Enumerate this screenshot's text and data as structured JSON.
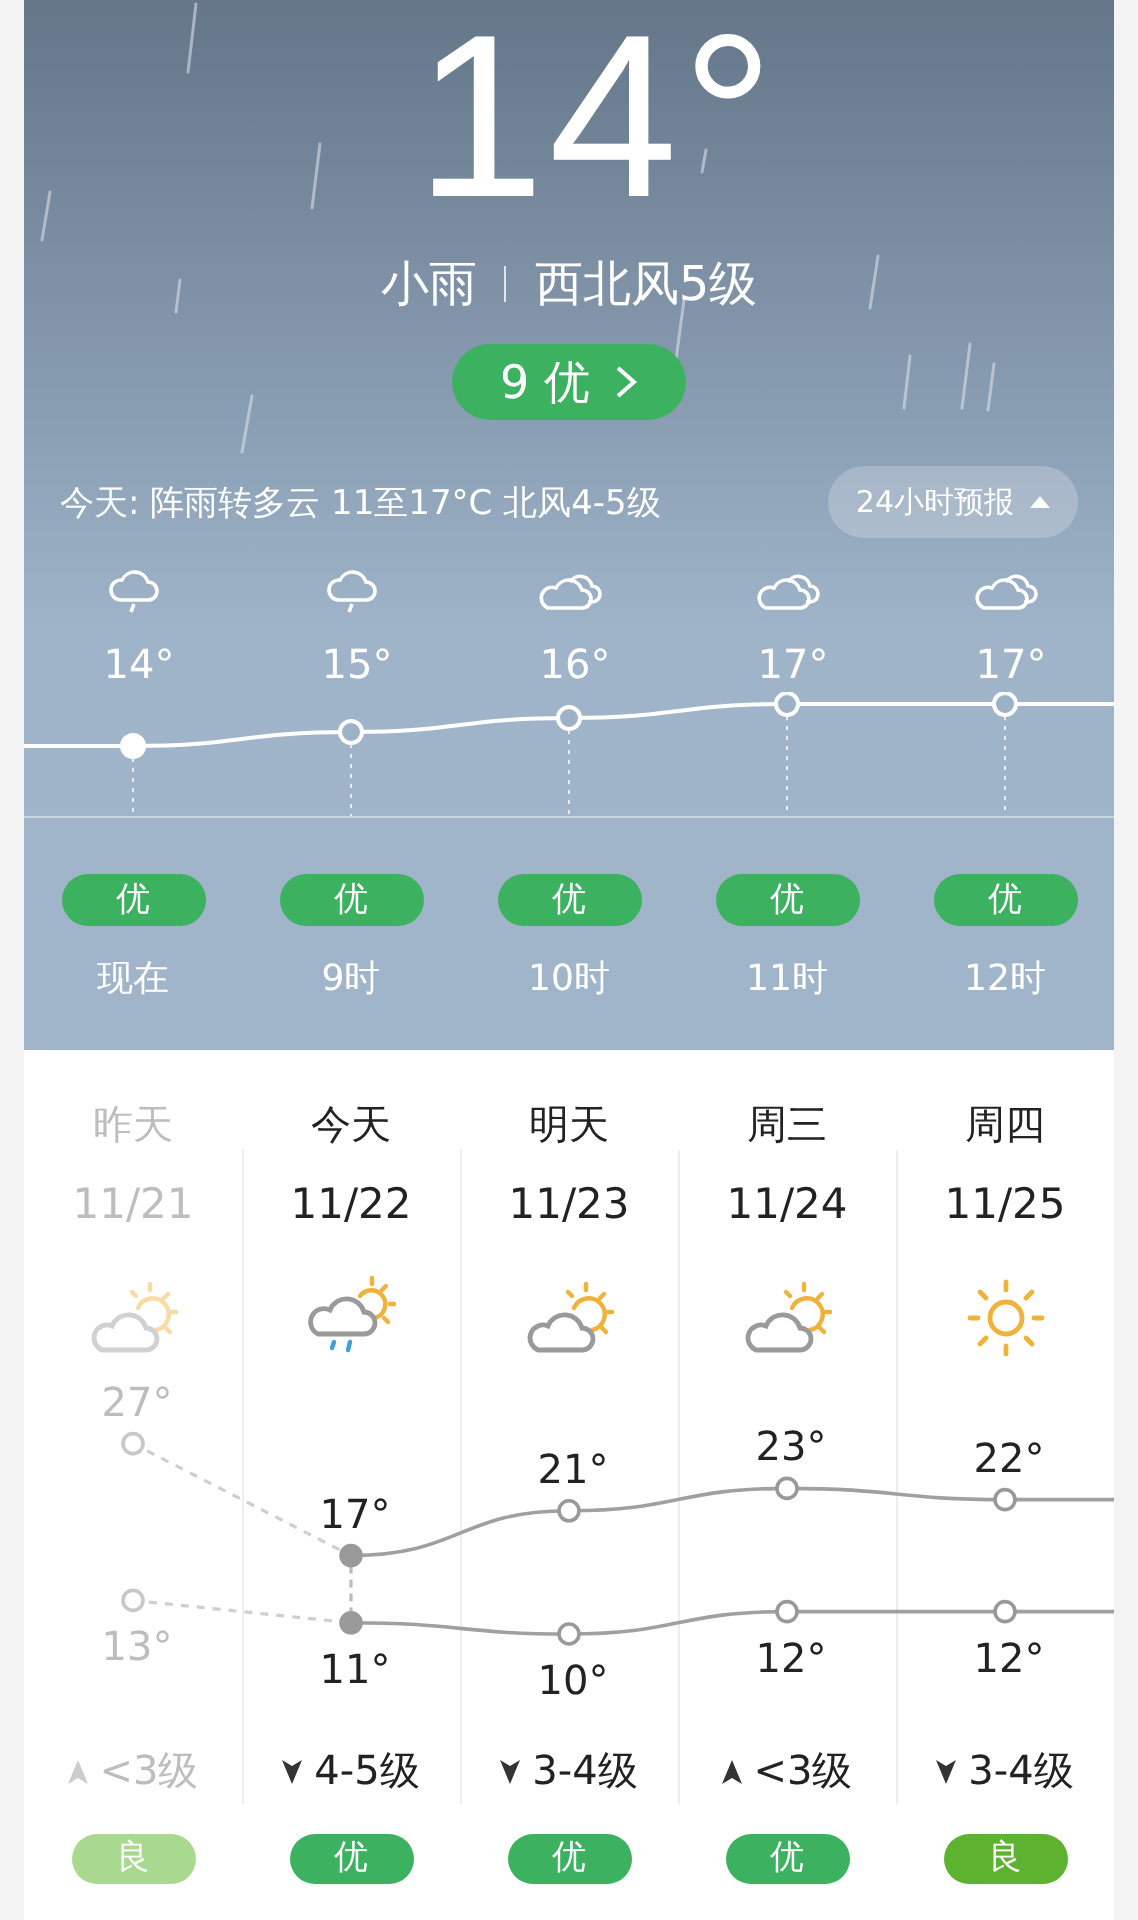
{
  "current": {
    "temperature": "14°",
    "condition": "小雨",
    "wind": "西北风5级",
    "aqi": "9 优"
  },
  "today_summary": "今天: 阵雨转多云 11至17°C 北风4-5级",
  "forecast_toggle": {
    "label": "24小时预报",
    "expanded": true
  },
  "hourly": [
    {
      "kind": "rain",
      "temp": "14°",
      "aqi": "优",
      "time": "现在",
      "current": true
    },
    {
      "kind": "rain",
      "temp": "15°",
      "aqi": "优",
      "time": "9时",
      "current": false
    },
    {
      "kind": "cloudy",
      "temp": "16°",
      "aqi": "优",
      "time": "10时",
      "current": false
    },
    {
      "kind": "cloudy",
      "temp": "17°",
      "aqi": "优",
      "time": "11时",
      "current": false
    },
    {
      "kind": "cloudy",
      "temp": "17°",
      "aqi": "优",
      "time": "12时",
      "current": false
    }
  ],
  "daily": [
    {
      "day": "昨天",
      "date": "11/21",
      "kind": "partly_cloudy",
      "high": "27°",
      "low": "13°",
      "wind_up": true,
      "wind": "<3级",
      "aqi": "良",
      "color": "#a9d88f",
      "past": true
    },
    {
      "day": "今天",
      "date": "11/22",
      "kind": "shower",
      "high": "17°",
      "low": "11°",
      "wind_up": false,
      "wind": "4-5级",
      "aqi": "优",
      "color": "#3cb15f",
      "past": false
    },
    {
      "day": "明天",
      "date": "11/23",
      "kind": "partly_cloudy",
      "high": "21°",
      "low": "10°",
      "wind_up": false,
      "wind": "3-4级",
      "aqi": "优",
      "color": "#3cb15f",
      "past": false
    },
    {
      "day": "周三",
      "date": "11/24",
      "kind": "partly_cloudy",
      "high": "23°",
      "low": "12°",
      "wind_up": true,
      "wind": "<3级",
      "aqi": "优",
      "color": "#3cb15f",
      "past": false
    },
    {
      "day": "周四",
      "date": "11/25",
      "kind": "sunny",
      "high": "22°",
      "low": "12°",
      "wind_up": false,
      "wind": "3-4级",
      "aqi": "良",
      "color": "#5db230",
      "past": false
    }
  ]
}
